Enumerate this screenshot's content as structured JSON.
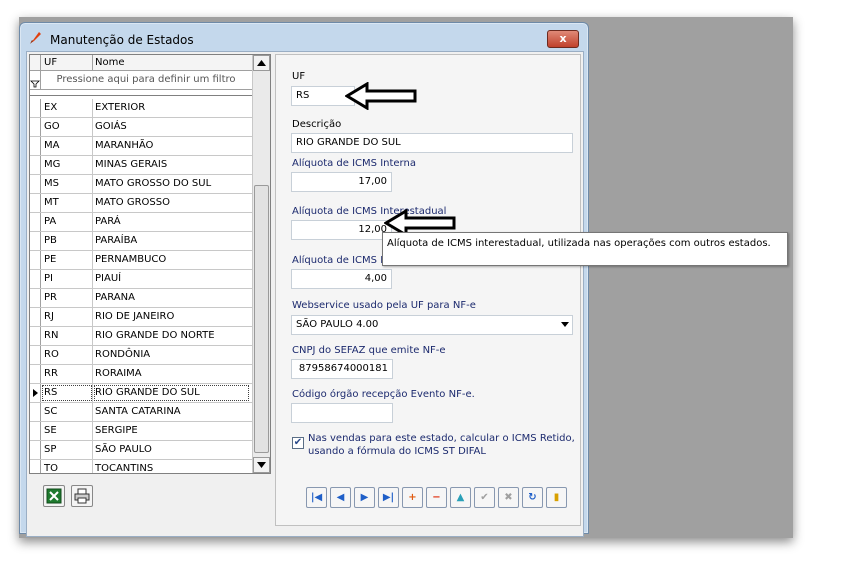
{
  "window": {
    "title": "Manutenção de Estados",
    "close_label": "x"
  },
  "grid": {
    "columns": [
      "UF",
      "Nome"
    ],
    "filter_placeholder": "Pressione aqui para definir um filtro",
    "rows": [
      {
        "uf": "EX",
        "nome": "EXTERIOR"
      },
      {
        "uf": "GO",
        "nome": "GOIÁS"
      },
      {
        "uf": "MA",
        "nome": "MARANHÃO"
      },
      {
        "uf": "MG",
        "nome": "MINAS GERAIS"
      },
      {
        "uf": "MS",
        "nome": "MATO GROSSO DO SUL"
      },
      {
        "uf": "MT",
        "nome": "MATO GROSSO"
      },
      {
        "uf": "PA",
        "nome": "PARÁ"
      },
      {
        "uf": "PB",
        "nome": "PARAÍBA"
      },
      {
        "uf": "PE",
        "nome": "PERNAMBUCO"
      },
      {
        "uf": "PI",
        "nome": "PIAUÍ"
      },
      {
        "uf": "PR",
        "nome": "PARANA"
      },
      {
        "uf": "RJ",
        "nome": "RIO DE JANEIRO"
      },
      {
        "uf": "RN",
        "nome": "RIO GRANDE DO NORTE"
      },
      {
        "uf": "RO",
        "nome": "RONDÔNIA"
      },
      {
        "uf": "RR",
        "nome": "RORAIMA"
      },
      {
        "uf": "RS",
        "nome": "RIO GRANDE DO SUL",
        "selected": true
      },
      {
        "uf": "SC",
        "nome": "SANTA CATARINA"
      },
      {
        "uf": "SE",
        "nome": "SERGIPE"
      },
      {
        "uf": "SP",
        "nome": "SÃO PAULO"
      },
      {
        "uf": "TO",
        "nome": "TOCANTINS"
      }
    ]
  },
  "form": {
    "uf_label": "UF",
    "uf_value": "RS",
    "descricao_label": "Descrição",
    "descricao_value": "RIO GRANDE DO SUL",
    "icms_interna_label": "Alíquota de ICMS Interna",
    "icms_interna_value": "17,00",
    "icms_interestadual_label": "Alíquota de ICMS Interestadual",
    "icms_interestadual_value": "12,00",
    "icms_third_label": "Alíquota de ICMS Ir",
    "icms_third_value": "4,00",
    "webservice_label": "Webservice usado pela UF para NF-e",
    "webservice_value": "SÃO PAULO 4.00",
    "cnpj_label": "CNPJ do SEFAZ que emite NF-e",
    "cnpj_value": "87958674000181",
    "codigo_label": "Código órgão recepção Evento NF-e.",
    "codigo_value": "",
    "checkbox_checked": true,
    "checkbox_line1": "Nas vendas para este estado, calcular o ICMS Retido,",
    "checkbox_line2": "usando a fórmula do ICMS ST DIFAL"
  },
  "tooltip": "Alíquota de ICMS interestadual, utilizada nas operações com outros estados.",
  "nav_buttons": [
    {
      "name": "first-record-button",
      "glyph": "|◀",
      "color": "#1f5fc8"
    },
    {
      "name": "prior-record-button",
      "glyph": "◀",
      "color": "#1f5fc8"
    },
    {
      "name": "next-record-button",
      "glyph": "▶",
      "color": "#1f5fc8"
    },
    {
      "name": "last-record-button",
      "glyph": "▶|",
      "color": "#1f5fc8"
    },
    {
      "name": "insert-record-button",
      "glyph": "+",
      "color": "#e05a10"
    },
    {
      "name": "delete-record-button",
      "glyph": "−",
      "color": "#e03010"
    },
    {
      "name": "edit-record-button",
      "glyph": "▲",
      "color": "#2aa0b8"
    },
    {
      "name": "post-record-button",
      "glyph": "✔",
      "color": "#a0a0a0"
    },
    {
      "name": "cancel-record-button",
      "glyph": "✖",
      "color": "#a0a0a0"
    },
    {
      "name": "refresh-button",
      "glyph": "↻",
      "color": "#1f5fc8"
    },
    {
      "name": "exit-button",
      "glyph": "▮",
      "color": "#d8a000"
    }
  ]
}
